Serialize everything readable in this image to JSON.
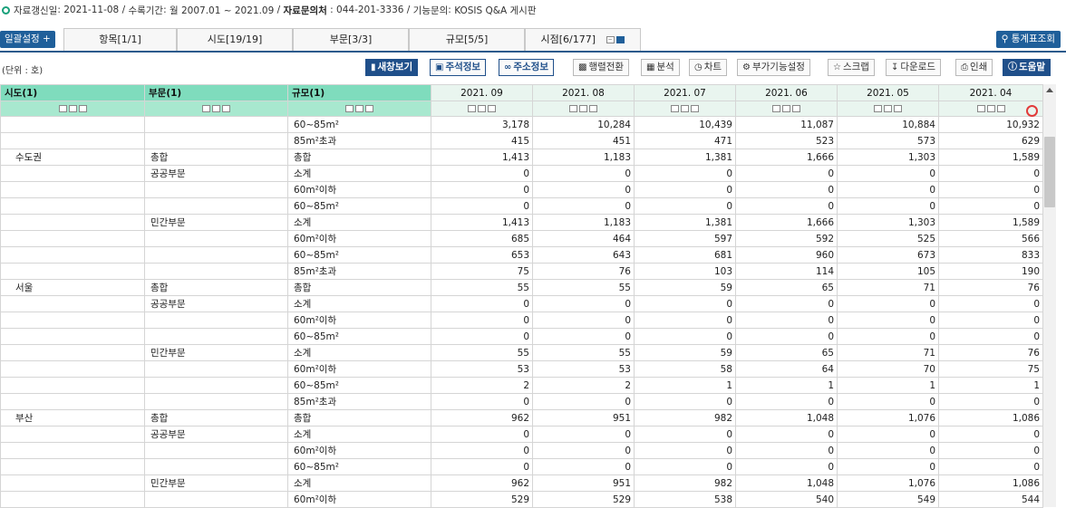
{
  "info": {
    "updated_label": "자료갱신일",
    "updated": "2021-11-08",
    "period_label": "수록기간",
    "period": "월 2007.01 ~ 2021.09",
    "contact_label": "자료문의처",
    "contact": "044-201-3336",
    "func_label": "기능문의",
    "func": "KOSIS Q&A 게시판"
  },
  "tabs": {
    "bulk": "일괄설정 +",
    "items": [
      "항목[1/1]",
      "시도[19/19]",
      "부문[3/3]",
      "규모[5/5]",
      "시점[6/177]"
    ],
    "stat_lookup": "통계표조회"
  },
  "toolbar": {
    "unit": "(단위 : 호)",
    "buttons": [
      "새창보기",
      "주석정보",
      "주소정보",
      "행렬전환",
      "분석",
      "차트",
      "부가기능설정",
      "스크랩",
      "다운로드",
      "인쇄",
      "도움말"
    ]
  },
  "table": {
    "headers": [
      "시도(1)",
      "부문(1)",
      "규모(1)"
    ],
    "periods": [
      "2021. 09",
      "2021. 08",
      "2021. 07",
      "2021. 06",
      "2021. 05",
      "2021. 04"
    ],
    "rows": [
      {
        "sido": "",
        "bumun": "",
        "gyumo": "60~85m²",
        "v": [
          "3,178",
          "10,284",
          "10,439",
          "11,087",
          "10,884",
          "10,932"
        ]
      },
      {
        "sido": "",
        "bumun": "",
        "gyumo": "85m²초과",
        "v": [
          "415",
          "451",
          "471",
          "523",
          "573",
          "629"
        ]
      },
      {
        "sido": "수도권",
        "bumun": "총합",
        "gyumo": "총합",
        "v": [
          "1,413",
          "1,183",
          "1,381",
          "1,666",
          "1,303",
          "1,589"
        ]
      },
      {
        "sido": "",
        "bumun": "공공부문",
        "gyumo": "소계",
        "v": [
          "0",
          "0",
          "0",
          "0",
          "0",
          "0"
        ]
      },
      {
        "sido": "",
        "bumun": "",
        "gyumo": "60m²이하",
        "v": [
          "0",
          "0",
          "0",
          "0",
          "0",
          "0"
        ]
      },
      {
        "sido": "",
        "bumun": "",
        "gyumo": "60~85m²",
        "v": [
          "0",
          "0",
          "0",
          "0",
          "0",
          "0"
        ]
      },
      {
        "sido": "",
        "bumun": "민간부문",
        "gyumo": "소계",
        "v": [
          "1,413",
          "1,183",
          "1,381",
          "1,666",
          "1,303",
          "1,589"
        ]
      },
      {
        "sido": "",
        "bumun": "",
        "gyumo": "60m²이하",
        "v": [
          "685",
          "464",
          "597",
          "592",
          "525",
          "566"
        ]
      },
      {
        "sido": "",
        "bumun": "",
        "gyumo": "60~85m²",
        "v": [
          "653",
          "643",
          "681",
          "960",
          "673",
          "833"
        ]
      },
      {
        "sido": "",
        "bumun": "",
        "gyumo": "85m²초과",
        "v": [
          "75",
          "76",
          "103",
          "114",
          "105",
          "190"
        ]
      },
      {
        "sido": "서울",
        "bumun": "총합",
        "gyumo": "총합",
        "v": [
          "55",
          "55",
          "59",
          "65",
          "71",
          "76"
        ]
      },
      {
        "sido": "",
        "bumun": "공공부문",
        "gyumo": "소계",
        "v": [
          "0",
          "0",
          "0",
          "0",
          "0",
          "0"
        ]
      },
      {
        "sido": "",
        "bumun": "",
        "gyumo": "60m²이하",
        "v": [
          "0",
          "0",
          "0",
          "0",
          "0",
          "0"
        ]
      },
      {
        "sido": "",
        "bumun": "",
        "gyumo": "60~85m²",
        "v": [
          "0",
          "0",
          "0",
          "0",
          "0",
          "0"
        ]
      },
      {
        "sido": "",
        "bumun": "민간부문",
        "gyumo": "소계",
        "v": [
          "55",
          "55",
          "59",
          "65",
          "71",
          "76"
        ]
      },
      {
        "sido": "",
        "bumun": "",
        "gyumo": "60m²이하",
        "v": [
          "53",
          "53",
          "58",
          "64",
          "70",
          "75"
        ]
      },
      {
        "sido": "",
        "bumun": "",
        "gyumo": "60~85m²",
        "v": [
          "2",
          "2",
          "1",
          "1",
          "1",
          "1"
        ]
      },
      {
        "sido": "",
        "bumun": "",
        "gyumo": "85m²초과",
        "v": [
          "0",
          "0",
          "0",
          "0",
          "0",
          "0"
        ]
      },
      {
        "sido": "부산",
        "bumun": "총합",
        "gyumo": "총합",
        "v": [
          "962",
          "951",
          "982",
          "1,048",
          "1,076",
          "1,086"
        ]
      },
      {
        "sido": "",
        "bumun": "공공부문",
        "gyumo": "소계",
        "v": [
          "0",
          "0",
          "0",
          "0",
          "0",
          "0"
        ]
      },
      {
        "sido": "",
        "bumun": "",
        "gyumo": "60m²이하",
        "v": [
          "0",
          "0",
          "0",
          "0",
          "0",
          "0"
        ]
      },
      {
        "sido": "",
        "bumun": "",
        "gyumo": "60~85m²",
        "v": [
          "0",
          "0",
          "0",
          "0",
          "0",
          "0"
        ]
      },
      {
        "sido": "",
        "bumun": "민간부문",
        "gyumo": "소계",
        "v": [
          "962",
          "951",
          "982",
          "1,048",
          "1,076",
          "1,086"
        ]
      },
      {
        "sido": "",
        "bumun": "",
        "gyumo": "60m²이하",
        "v": [
          "529",
          "529",
          "538",
          "540",
          "549",
          "544"
        ]
      }
    ]
  }
}
